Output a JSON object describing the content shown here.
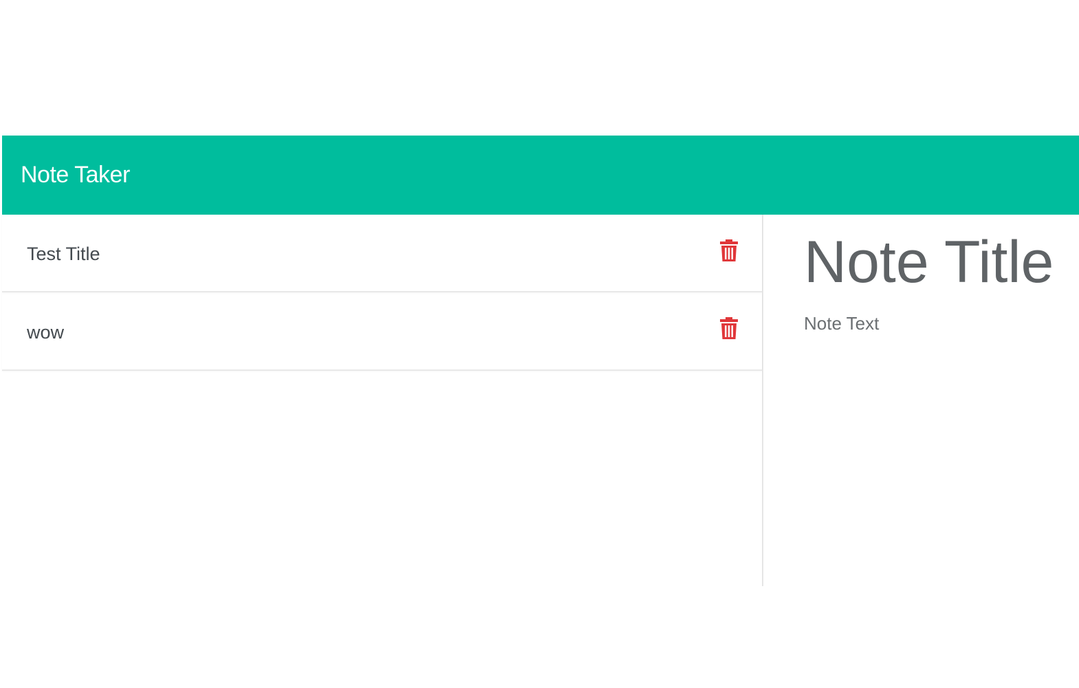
{
  "colors": {
    "navbar_bg": "#00bd9d",
    "delete_icon": "#e0373a",
    "text_dark": "#444a4f",
    "text_muted": "#5f6366"
  },
  "navbar": {
    "brand": "Note Taker"
  },
  "sidebar": {
    "notes": [
      {
        "title": "Test Title",
        "delete_icon": "trash-icon"
      },
      {
        "title": "wow",
        "delete_icon": "trash-icon"
      }
    ]
  },
  "editor": {
    "title_placeholder": "Note Title",
    "text_placeholder": "Note Text"
  }
}
